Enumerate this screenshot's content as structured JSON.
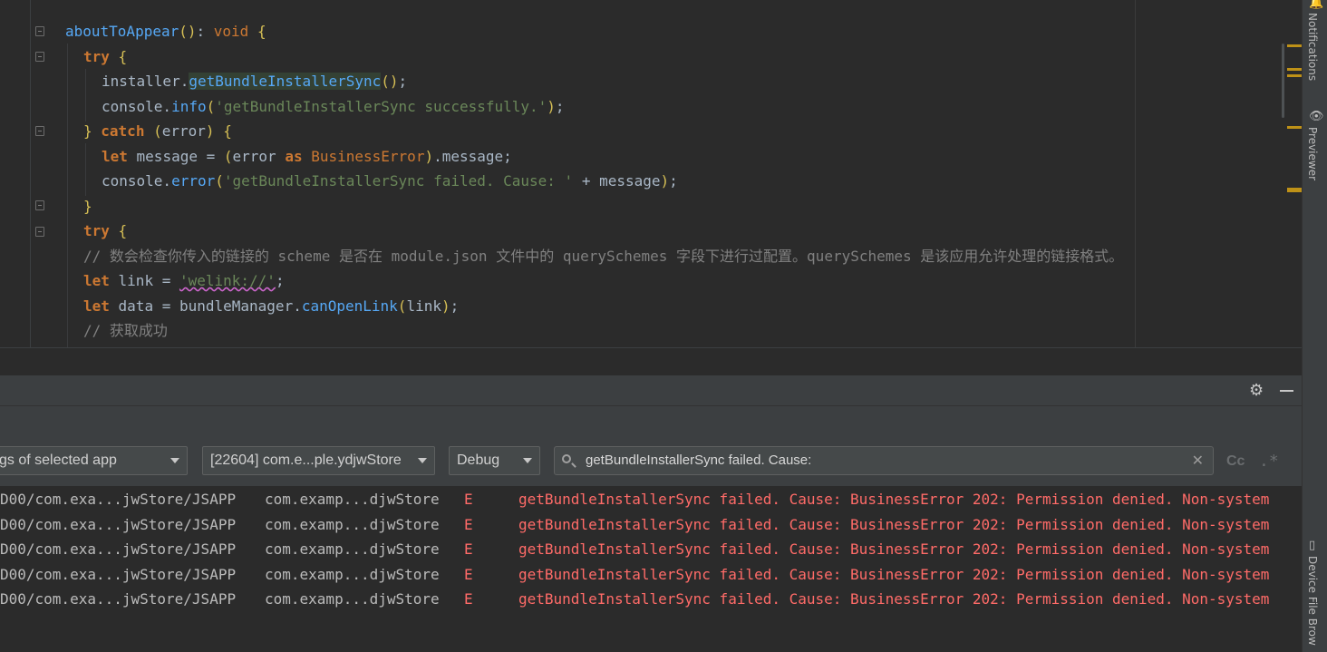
{
  "editor": {
    "lines": [
      {
        "indent": 0,
        "tokens": [
          [
            "fn",
            "aboutToAppear"
          ],
          [
            "br",
            "()"
          ],
          [
            "var",
            ": "
          ],
          [
            "kwn",
            "void"
          ],
          [
            "var",
            " "
          ],
          [
            "br",
            "{"
          ]
        ]
      },
      {
        "indent": 1,
        "tokens": [
          [
            "kw",
            "try"
          ],
          [
            "var",
            " "
          ],
          [
            "br",
            "{"
          ]
        ]
      },
      {
        "indent": 2,
        "tokens": [
          [
            "var",
            "installer."
          ],
          [
            "hl",
            "getBundleInstallerSync"
          ],
          [
            "br",
            "()"
          ],
          [
            "var",
            ";"
          ]
        ]
      },
      {
        "indent": 2,
        "tokens": [
          [
            "var",
            "console."
          ],
          [
            "fn",
            "info"
          ],
          [
            "br",
            "("
          ],
          [
            "str",
            "'getBundleInstallerSync successfully.'"
          ],
          [
            "br",
            ")"
          ],
          [
            "var",
            ";"
          ]
        ]
      },
      {
        "indent": 1,
        "tokens": [
          [
            "br",
            "}"
          ],
          [
            "var",
            " "
          ],
          [
            "kw",
            "catch"
          ],
          [
            "var",
            " "
          ],
          [
            "br",
            "("
          ],
          [
            "var",
            "error"
          ],
          [
            "br",
            ")"
          ],
          [
            "var",
            " "
          ],
          [
            "br",
            "{"
          ]
        ]
      },
      {
        "indent": 2,
        "tokens": [
          [
            "kw",
            "let"
          ],
          [
            "var",
            " message = "
          ],
          [
            "br",
            "("
          ],
          [
            "var",
            "error "
          ],
          [
            "kw",
            "as"
          ],
          [
            "var",
            " "
          ],
          [
            "cls",
            "BusinessError"
          ],
          [
            "br",
            ")"
          ],
          [
            "var",
            ".message;"
          ]
        ]
      },
      {
        "indent": 2,
        "tokens": [
          [
            "var",
            "console."
          ],
          [
            "fn",
            "error"
          ],
          [
            "br",
            "("
          ],
          [
            "str",
            "'getBundleInstallerSync failed. Cause: '"
          ],
          [
            "var",
            " + message"
          ],
          [
            "br",
            ")"
          ],
          [
            "var",
            ";"
          ]
        ]
      },
      {
        "indent": 1,
        "tokens": [
          [
            "br",
            "}"
          ]
        ]
      },
      {
        "indent": 1,
        "tokens": [
          [
            "kw",
            "try"
          ],
          [
            "var",
            " "
          ],
          [
            "br",
            "{"
          ]
        ]
      },
      {
        "indent": 1,
        "tokens": [
          [
            "cm",
            "// 数会检查你传入的链接的 scheme 是否在 module.json 文件中的 querySchemes 字段下进行过配置。querySchemes 是该应用允许处理的链接格式。"
          ]
        ]
      },
      {
        "indent": 1,
        "tokens": [
          [
            "kw",
            "let"
          ],
          [
            "var",
            " link = "
          ],
          [
            "lnk",
            "'welink://'"
          ],
          [
            "var",
            ";"
          ]
        ]
      },
      {
        "indent": 1,
        "tokens": [
          [
            "kw",
            "let"
          ],
          [
            "var",
            " data = bundleManager."
          ],
          [
            "fn",
            "canOpenLink"
          ],
          [
            "br",
            "("
          ],
          [
            "var",
            "link"
          ],
          [
            "br",
            ")"
          ],
          [
            "var",
            ";"
          ]
        ]
      },
      {
        "indent": 1,
        "tokens": [
          [
            "cm",
            "// 获取成功"
          ]
        ]
      }
    ]
  },
  "right_strip": {
    "notifications_label": "Notifications",
    "previewer_label": "Previewer",
    "device_file_label": "Device File Brow"
  },
  "panel": {
    "toolbar": {
      "filter_mode": "gs of selected app",
      "process": "[22604] com.e...ple.ydjwStore",
      "log_level": "Debug",
      "search_value": "getBundleInstallerSync failed. Cause:",
      "match_case_label": "Cc",
      "regex_label": ".*"
    },
    "log_rows": [
      {
        "tag": "D00/com.exa...jwStore/JSAPP",
        "pkg": "com.examp...djwStore",
        "level": "E",
        "message": "getBundleInstallerSync failed. Cause: BusinessError 202: Permission denied. Non-system"
      },
      {
        "tag": "D00/com.exa...jwStore/JSAPP",
        "pkg": "com.examp...djwStore",
        "level": "E",
        "message": "getBundleInstallerSync failed. Cause: BusinessError 202: Permission denied. Non-system"
      },
      {
        "tag": "D00/com.exa...jwStore/JSAPP",
        "pkg": "com.examp...djwStore",
        "level": "E",
        "message": "getBundleInstallerSync failed. Cause: BusinessError 202: Permission denied. Non-system"
      },
      {
        "tag": "D00/com.exa...jwStore/JSAPP",
        "pkg": "com.examp...djwStore",
        "level": "E",
        "message": "getBundleInstallerSync failed. Cause: BusinessError 202: Permission denied. Non-system"
      },
      {
        "tag": "D00/com.exa...jwStore/JSAPP",
        "pkg": "com.examp...djwStore",
        "level": "E",
        "message": "getBundleInstallerSync failed. Cause: BusinessError 202: Permission denied. Non-system"
      }
    ]
  },
  "colors": {
    "editor_bg": "#2b2b2b",
    "panel_bg": "#3c3f41",
    "error": "#ff6b68",
    "keyword": "#cc7832",
    "function": "#56a8f5",
    "string": "#6a8759"
  }
}
